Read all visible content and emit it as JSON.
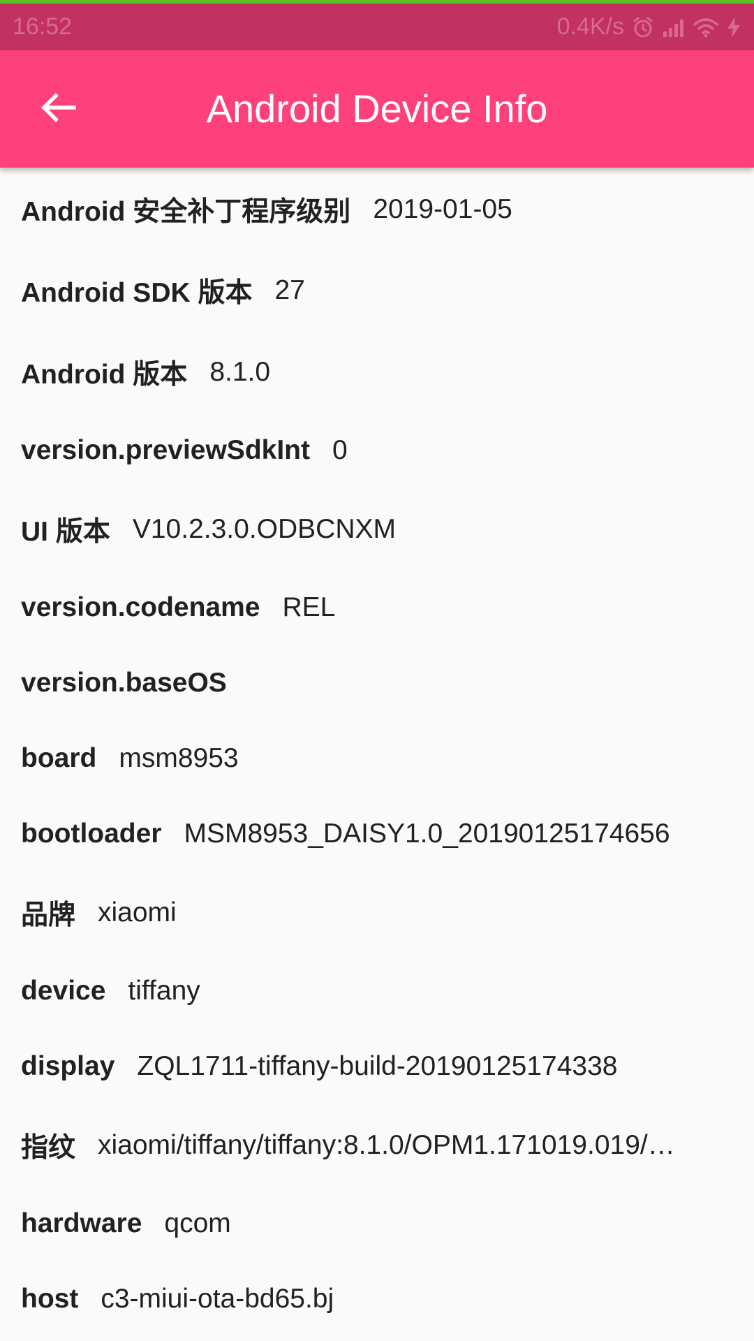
{
  "status_bar": {
    "time": "16:52",
    "net_speed": "0.4K/s",
    "icons": [
      "alarm-icon",
      "signal-icon",
      "wifi-icon",
      "charging-icon"
    ]
  },
  "app_bar": {
    "title": "Android Device Info",
    "back_icon": "arrow-back-icon"
  },
  "colors": {
    "app_bar": "#fe417c",
    "status_bar": "#c13262",
    "top_accent": "#58c322",
    "background": "#fafafa",
    "text": "#212121"
  },
  "rows": [
    {
      "key": "Android 安全补丁程序级别",
      "value": "2019-01-05"
    },
    {
      "key": "Android SDK 版本",
      "value": "27"
    },
    {
      "key": "Android 版本",
      "value": "8.1.0"
    },
    {
      "key": "version.previewSdkInt",
      "value": "0"
    },
    {
      "key": "UI 版本",
      "value": "V10.2.3.0.ODBCNXM"
    },
    {
      "key": "version.codename",
      "value": "REL"
    },
    {
      "key": "version.baseOS",
      "value": ""
    },
    {
      "key": "board",
      "value": "msm8953"
    },
    {
      "key": "bootloader",
      "value": "MSM8953_DAISY1.0_20190125174656"
    },
    {
      "key": "品牌",
      "value": "xiaomi"
    },
    {
      "key": "device",
      "value": "tiffany"
    },
    {
      "key": "display",
      "value": "ZQL1711-tiffany-build-20190125174338"
    },
    {
      "key": "指纹",
      "value": "xiaomi/tiffany/tiffany:8.1.0/OPM1.171019.019/…"
    },
    {
      "key": "hardware",
      "value": "qcom"
    },
    {
      "key": "host",
      "value": "c3-miui-ota-bd65.bj"
    }
  ]
}
